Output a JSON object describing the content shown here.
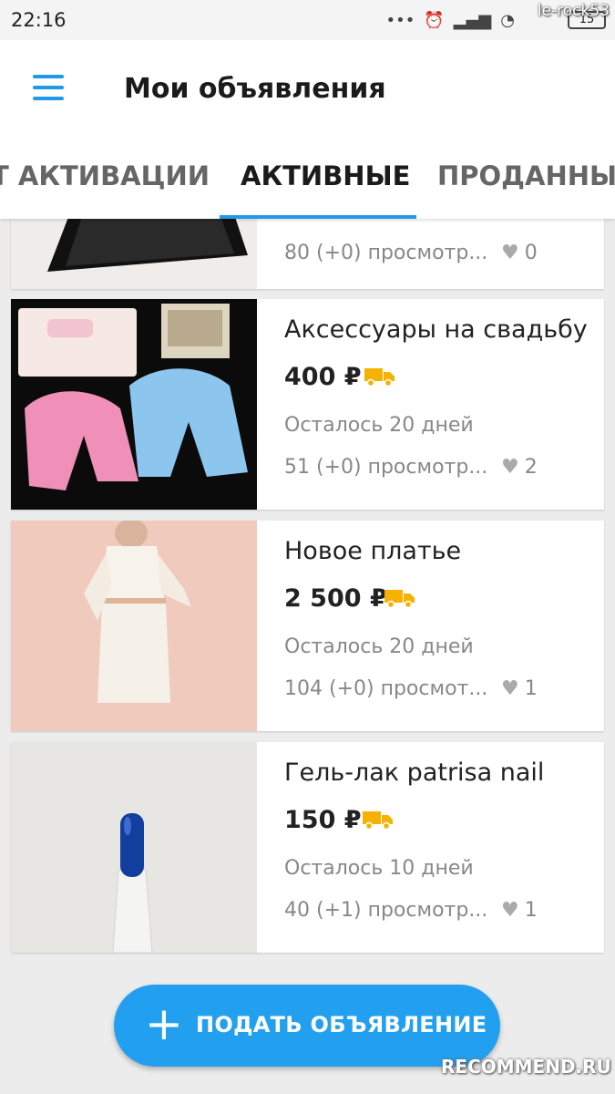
{
  "status": {
    "time": "22:16",
    "battery": "15"
  },
  "watermark_top": "le-rock53",
  "appbar": {
    "title": "Мои объявления"
  },
  "tabs": [
    {
      "label": "НА АКТИВАЦИИ",
      "visible_label": "Т АКТИВАЦИИ",
      "active": false
    },
    {
      "label": "АКТИВНЫЕ",
      "active": true
    },
    {
      "label": "ПРОДАННЫЕ",
      "visible_label": "ПРОДАННЫЕ",
      "active": false
    }
  ],
  "listings": [
    {
      "views": "80 (+0) просмотр...",
      "likes": "0"
    },
    {
      "title": "Аксессуары на свадьбу",
      "price": "400 ₽",
      "remaining": "Осталось 20 дней",
      "views": "51 (+0) просмотр...",
      "likes": "2"
    },
    {
      "title": "Новое платье",
      "price": "2 500 ₽",
      "remaining": "Осталось 20 дней",
      "views": "104 (+0) просмот...",
      "likes": "1"
    },
    {
      "title": "Гель-лак patrisa nail",
      "price": "150 ₽",
      "remaining": "Осталось 10 дней",
      "views": "40 (+1) просмотр...",
      "likes": "1"
    }
  ],
  "fab": {
    "label": "ПОДАТЬ ОБЪЯВЛЕНИЕ"
  },
  "watermark_bottom": "RECOMMEND.RU",
  "colors": {
    "accent": "#1f9ae8",
    "fab": "#22a0ef",
    "truck": "#f5b200"
  }
}
